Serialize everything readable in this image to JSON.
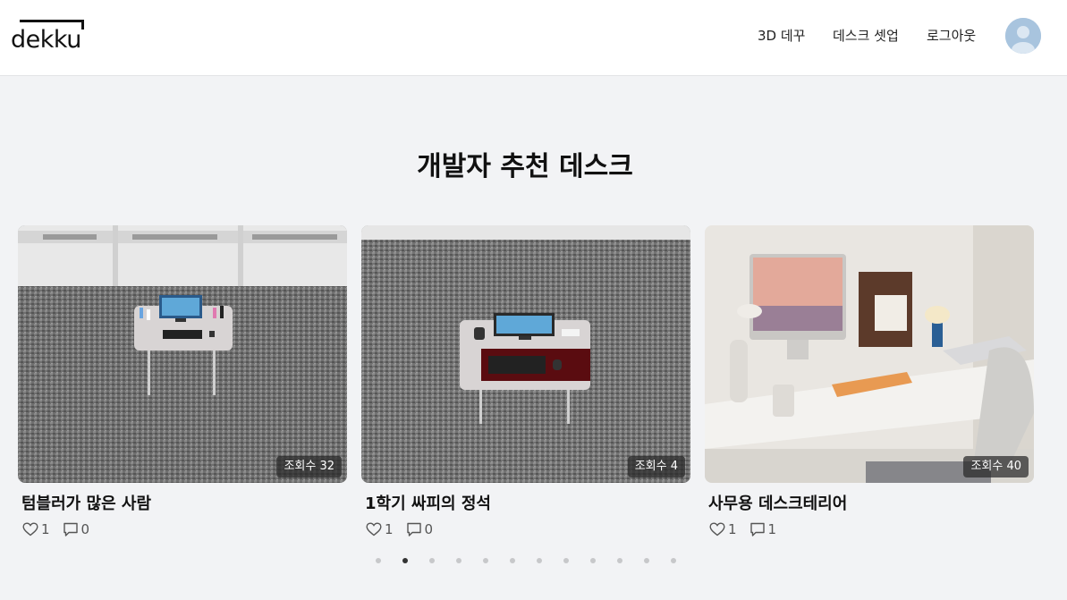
{
  "header": {
    "logo_text": "dekku",
    "nav": {
      "demo": "3D 데꾸",
      "setup": "데스크 셋업",
      "logout": "로그아웃"
    }
  },
  "section": {
    "title": "개발자 추천 데스크"
  },
  "cards": [
    {
      "title": "텀블러가 많은 사람",
      "views": "조회수 32",
      "likes": "1",
      "comments": "0"
    },
    {
      "title": "1학기 싸피의 정석",
      "views": "조회수 4",
      "likes": "1",
      "comments": "0"
    },
    {
      "title": "사무용 데스크테리어",
      "views": "조회수 40",
      "likes": "1",
      "comments": "1"
    }
  ],
  "pagination": {
    "total": 12,
    "active": 2
  },
  "icons": {
    "like": "heart-outline-icon",
    "comment": "speech-bubble-icon",
    "avatar": "user-avatar-icon"
  },
  "colors": {
    "background": "#f2f3f5",
    "header": "#ffffff",
    "avatar": "#a8c4de",
    "active_dot": "#333333"
  }
}
